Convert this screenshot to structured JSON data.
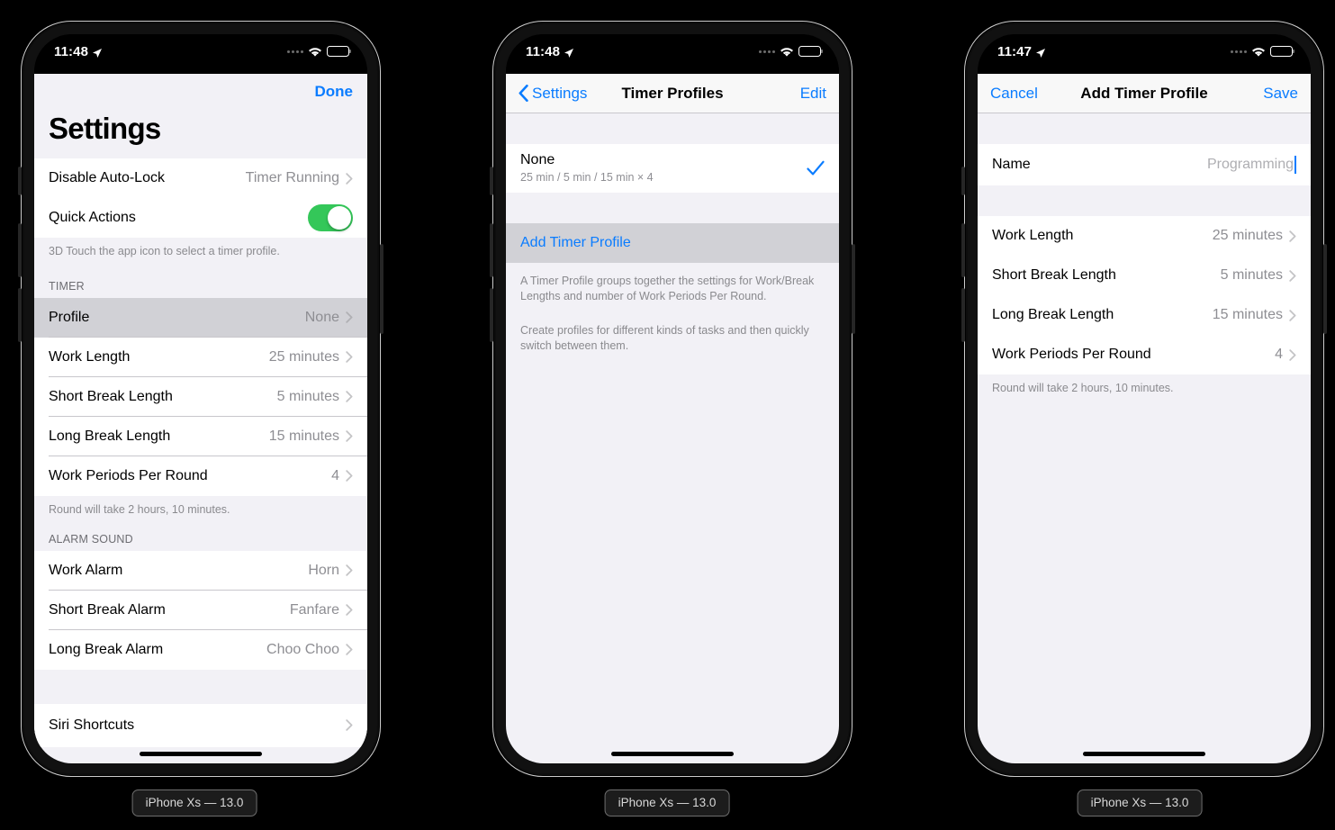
{
  "colors": {
    "accent_blue": "#0a7cff",
    "switch_green": "#34c759",
    "group_bg": "#f2f1f6",
    "cell_bg": "#ffffff",
    "selected_row": "#d1d1d6",
    "separator": "#c8c7cc",
    "secondary_text": "#8e8e93",
    "frame": "#111111"
  },
  "devices": [
    {
      "caption": "iPhone Xs — 13.0"
    },
    {
      "caption": "iPhone Xs — 13.0"
    },
    {
      "caption": "iPhone Xs — 13.0"
    }
  ],
  "phone1": {
    "status": {
      "time": "11:48",
      "location_icon": "location-arrow-icon",
      "signal_icon": "cellular-dots-icon",
      "wifi_icon": "wifi-icon",
      "battery_icon": "battery-icon"
    },
    "modal": {
      "done_label": "Done",
      "title": "Settings"
    },
    "rows_top": [
      {
        "label": "Disable Auto-Lock",
        "value": "Timer Running",
        "accessory": "chevron-right-icon"
      }
    ],
    "quick_actions": {
      "label": "Quick Actions",
      "state": "on"
    },
    "quick_actions_footnote": "3D Touch the app icon to select a timer profile.",
    "timer_header": "TIMER",
    "timer_rows": [
      {
        "label": "Profile",
        "value": "None",
        "selected": true
      },
      {
        "label": "Work Length",
        "value": "25 minutes",
        "selected": false
      },
      {
        "label": "Short Break Length",
        "value": "5 minutes",
        "selected": false
      },
      {
        "label": "Long Break Length",
        "value": "15 minutes",
        "selected": false
      },
      {
        "label": "Work Periods Per Round",
        "value": "4",
        "selected": false
      }
    ],
    "timer_footnote": "Round will take 2 hours, 10 minutes.",
    "alarm_header": "ALARM SOUND",
    "alarm_rows": [
      {
        "label": "Work Alarm",
        "value": "Horn"
      },
      {
        "label": "Short Break Alarm",
        "value": "Fanfare"
      },
      {
        "label": "Long Break Alarm",
        "value": "Choo Choo"
      }
    ],
    "siri_row": {
      "label": "Siri Shortcuts",
      "value": ""
    }
  },
  "phone2": {
    "status": {
      "time": "11:48",
      "location_icon": "location-arrow-icon",
      "signal_icon": "cellular-dots-icon",
      "wifi_icon": "wifi-icon",
      "battery_icon": "battery-icon"
    },
    "nav": {
      "back_label": "Settings",
      "title": "Timer Profiles",
      "edit_label": "Edit"
    },
    "profiles": [
      {
        "name": "None",
        "detail": "25 min / 5 min / 15 min × 4",
        "checked": true
      }
    ],
    "add_action": "Add Timer Profile",
    "footnotes": [
      "A Timer Profile groups together the settings for Work/Break Lengths and number of Work Periods Per Round.",
      "Create profiles for different kinds of tasks and then quickly switch between them."
    ]
  },
  "phone3": {
    "status": {
      "time": "11:47",
      "location_icon": "location-arrow-icon",
      "signal_icon": "cellular-dots-icon",
      "wifi_icon": "wifi-icon",
      "battery_icon": "battery-icon"
    },
    "nav": {
      "cancel_label": "Cancel",
      "title": "Add Timer Profile",
      "save_label": "Save"
    },
    "name_row": {
      "label": "Name",
      "placeholder": "Programming",
      "value": ""
    },
    "rows": [
      {
        "label": "Work Length",
        "value": "25 minutes"
      },
      {
        "label": "Short Break Length",
        "value": "5 minutes"
      },
      {
        "label": "Long Break Length",
        "value": "15 minutes"
      },
      {
        "label": "Work Periods Per Round",
        "value": "4"
      }
    ],
    "footnote": "Round will take 2 hours, 10 minutes."
  }
}
